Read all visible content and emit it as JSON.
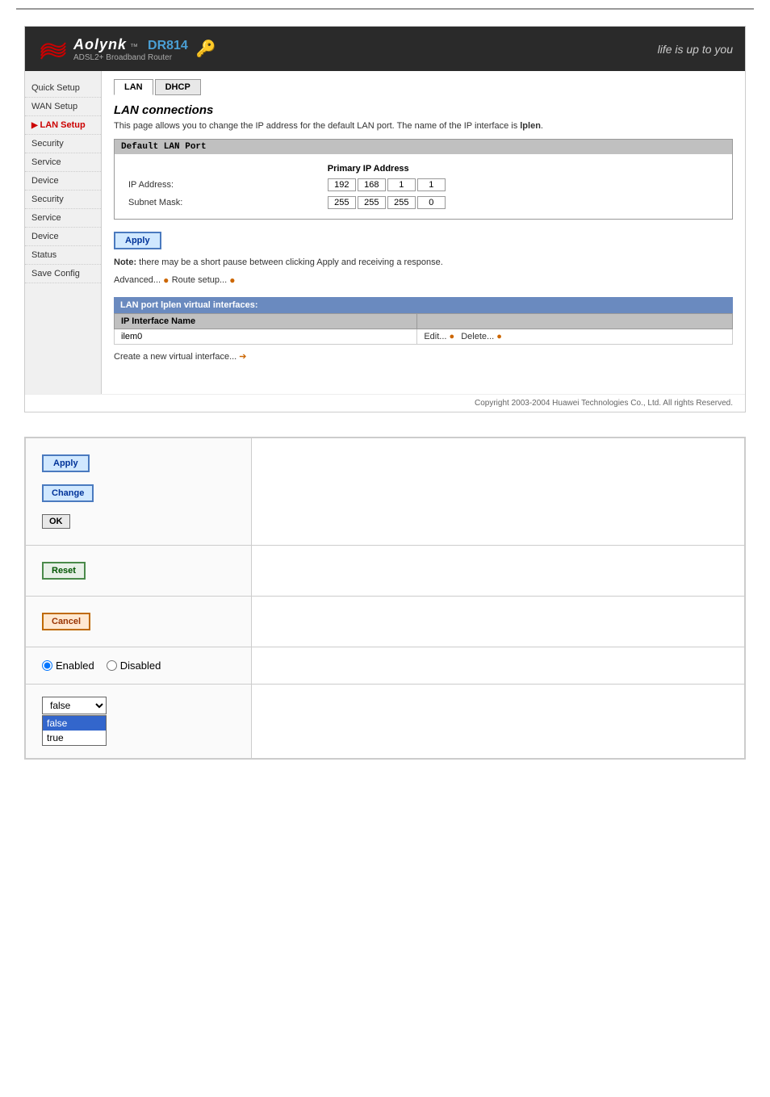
{
  "topLine": {},
  "router": {
    "brand": "Aolynk",
    "trademark": "™",
    "model": "DR814",
    "subtitle": "ADSL2+ Broadband Router",
    "slogan": "life is up to you",
    "header": {
      "tab_lan": "LAN",
      "tab_dhcp": "DHCP"
    },
    "sidebar": {
      "items": [
        {
          "label": "Quick Setup",
          "active": false
        },
        {
          "label": "WAN Setup",
          "active": false
        },
        {
          "label": "▶ LAN Setup",
          "active": true,
          "selected": true
        },
        {
          "label": "Security",
          "active": false
        },
        {
          "label": "Service",
          "active": false
        },
        {
          "label": "Device",
          "active": false
        },
        {
          "label": "Security",
          "active": false
        },
        {
          "label": "Service",
          "active": false
        },
        {
          "label": "Device",
          "active": false
        },
        {
          "label": "Status",
          "active": false
        },
        {
          "label": "Save Config",
          "active": false
        }
      ]
    },
    "content": {
      "page_title": "LAN connections",
      "page_desc": "This page allows you to change the IP address for the default LAN port. The name of the IP interface is lplen.",
      "section_title": "Default LAN Port",
      "primary_ip_label": "Primary IP Address",
      "ip_address_label": "IP Address:",
      "subnet_mask_label": "Subnet Mask:",
      "ip_octets": [
        "192",
        "168",
        "1",
        "1"
      ],
      "subnet_octets": [
        "255",
        "255",
        "255",
        "0"
      ],
      "apply_btn": "Apply",
      "note": "Note: there may be a short pause between clicking Apply and receiving a response.",
      "advanced_link": "Advanced...",
      "route_setup_link": "Route setup...",
      "lan_section_header": "LAN port lplen virtual interfaces:",
      "table_header": "IP Interface Name",
      "table_row": "ilem0",
      "edit_link": "Edit...",
      "delete_link": "Delete...",
      "create_link": "Create a new virtual interface..."
    }
  },
  "footer": {
    "copyright": "Copyright 2003-2004 Huawei Technologies Co., Ltd. All rights Reserved."
  },
  "showcase": {
    "rows": [
      {
        "id": "buttons-primary",
        "buttons": [
          "Apply",
          "Change",
          "OK"
        ]
      },
      {
        "id": "button-reset",
        "buttons": [
          "Reset"
        ]
      },
      {
        "id": "button-cancel",
        "buttons": [
          "Cancel"
        ]
      },
      {
        "id": "radio-group",
        "enabled_label": "Enabled",
        "disabled_label": "Disabled"
      },
      {
        "id": "dropdown",
        "options": [
          "false",
          "true"
        ],
        "selected": "false"
      }
    ]
  }
}
